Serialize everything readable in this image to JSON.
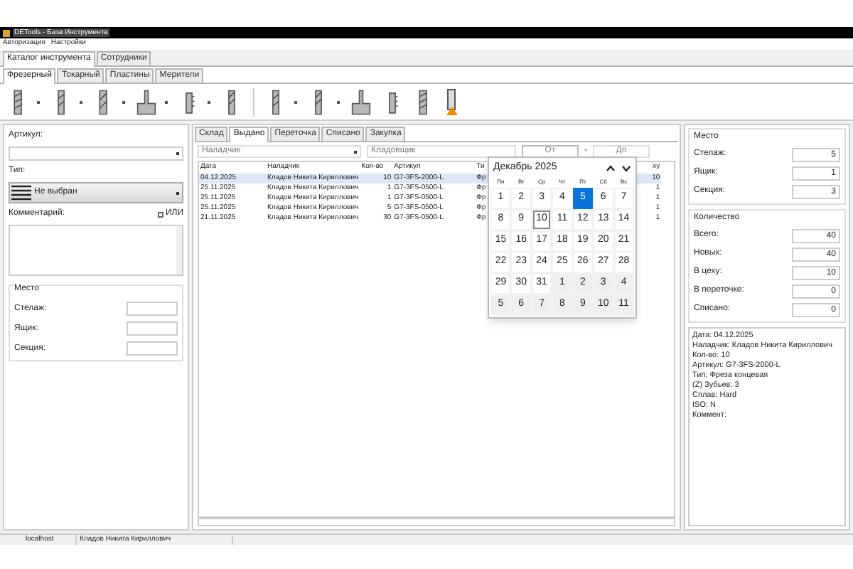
{
  "window": {
    "title": "DETools - База Инструмента"
  },
  "menu": [
    "Авторизация",
    "Настройки"
  ],
  "main_tabs": [
    {
      "label": "Каталог инструмента",
      "selected": true
    },
    {
      "label": "Сотрудники",
      "selected": false
    }
  ],
  "category_tabs": [
    {
      "label": "Фрезерный",
      "selected": true
    },
    {
      "label": "Токарный",
      "selected": false
    },
    {
      "label": "Пластины",
      "selected": false
    },
    {
      "label": "Мерители",
      "selected": false
    }
  ],
  "filters": {
    "article_label": "Артикул:",
    "type_label": "Тип:",
    "type_value": "Не выбран",
    "comment_label": "Комментарий:",
    "or_checkbox": {
      "label": "ИЛИ",
      "checked": false
    },
    "place": {
      "title": "Место",
      "fields": [
        "Стелаж:",
        "Ящик:",
        "Секция:"
      ]
    }
  },
  "record_tabs": [
    {
      "label": "Склад",
      "selected": false
    },
    {
      "label": "Выдано",
      "selected": true
    },
    {
      "label": "Переточка",
      "selected": false
    },
    {
      "label": "Списано",
      "selected": false
    },
    {
      "label": "Закупка",
      "selected": false
    }
  ],
  "record_filters": {
    "adjuster_value": "Наладчик",
    "storekeeper_placeholder": "Кладовщик",
    "from_placeholder": "От",
    "separator": "-",
    "to_placeholder": "До"
  },
  "table": {
    "columns": [
      "Дата",
      "Наладчик",
      "Кол-во",
      "Артикул",
      "Ти",
      "ху"
    ],
    "rows": [
      {
        "cells": [
          "04.12.2025",
          "Кладов Никита Кириллович",
          "10",
          "G7-3FS-2000-L",
          "Фр",
          "10"
        ],
        "selected": true
      },
      {
        "cells": [
          "25.11.2025",
          "Кладов Никита Кириллович",
          "1",
          "G7-3FS-0500-L",
          "Фр",
          "1"
        ],
        "selected": false
      },
      {
        "cells": [
          "25.11.2025",
          "Кладов Никита Кириллович",
          "1",
          "G7-3FS-0500-L",
          "Фр",
          "1"
        ],
        "selected": false
      },
      {
        "cells": [
          "25.11.2025",
          "Кладов Никита Кириллович",
          "5",
          "G7-3FS-0500-L",
          "Фр",
          "1"
        ],
        "selected": false
      },
      {
        "cells": [
          "21.11.2025",
          "Кладов Никита Кириллович",
          "30",
          "G7-3FS-0500-L",
          "Фр",
          "1"
        ],
        "selected": false
      }
    ]
  },
  "calendar": {
    "month": "Декабрь 2025",
    "weekdays": [
      "Пн",
      "Вт",
      "Ср",
      "Чт",
      "Пт",
      "Сб",
      "Вс"
    ],
    "days": [
      {
        "label": "1",
        "other_month": false,
        "selected": false,
        "today": false
      },
      {
        "label": "2",
        "other_month": false,
        "selected": false,
        "today": false
      },
      {
        "label": "3",
        "other_month": false,
        "selected": false,
        "today": false
      },
      {
        "label": "4",
        "other_month": false,
        "selected": false,
        "today": false
      },
      {
        "label": "5",
        "other_month": false,
        "selected": true,
        "today": false
      },
      {
        "label": "6",
        "other_month": false,
        "selected": false,
        "today": false
      },
      {
        "label": "7",
        "other_month": false,
        "selected": false,
        "today": false
      },
      {
        "label": "8",
        "other_month": false,
        "selected": false,
        "today": false
      },
      {
        "label": "9",
        "other_month": false,
        "selected": false,
        "today": false
      },
      {
        "label": "10",
        "other_month": false,
        "selected": false,
        "today": true
      },
      {
        "label": "11",
        "other_month": false,
        "selected": false,
        "today": false
      },
      {
        "label": "12",
        "other_month": false,
        "selected": false,
        "today": false
      },
      {
        "label": "13",
        "other_month": false,
        "selected": false,
        "today": false
      },
      {
        "label": "14",
        "other_month": false,
        "selected": false,
        "today": false
      },
      {
        "label": "15",
        "other_month": false,
        "selected": false,
        "today": false
      },
      {
        "label": "16",
        "other_month": false,
        "selected": false,
        "today": false
      },
      {
        "label": "17",
        "other_month": false,
        "selected": false,
        "today": false
      },
      {
        "label": "18",
        "other_month": false,
        "selected": false,
        "today": false
      },
      {
        "label": "19",
        "other_month": false,
        "selected": false,
        "today": false
      },
      {
        "label": "20",
        "other_month": false,
        "selected": false,
        "today": false
      },
      {
        "label": "21",
        "other_month": false,
        "selected": false,
        "today": false
      },
      {
        "label": "22",
        "other_month": false,
        "selected": false,
        "today": false
      },
      {
        "label": "23",
        "other_month": false,
        "selected": false,
        "today": false
      },
      {
        "label": "24",
        "other_month": false,
        "selected": false,
        "today": false
      },
      {
        "label": "25",
        "other_month": false,
        "selected": false,
        "today": false
      },
      {
        "label": "26",
        "other_month": false,
        "selected": false,
        "today": false
      },
      {
        "label": "27",
        "other_month": false,
        "selected": false,
        "today": false
      },
      {
        "label": "28",
        "other_month": false,
        "selected": false,
        "today": false
      },
      {
        "label": "29",
        "other_month": false,
        "selected": false,
        "today": false
      },
      {
        "label": "30",
        "other_month": false,
        "selected": false,
        "today": false
      },
      {
        "label": "31",
        "other_month": false,
        "selected": false,
        "today": false
      },
      {
        "label": "1",
        "other_month": true,
        "selected": false,
        "today": false
      },
      {
        "label": "2",
        "other_month": true,
        "selected": false,
        "today": false
      },
      {
        "label": "3",
        "other_month": true,
        "selected": false,
        "today": false
      },
      {
        "label": "4",
        "other_month": true,
        "selected": false,
        "today": false
      },
      {
        "label": "5",
        "other_month": true,
        "selected": false,
        "today": false
      },
      {
        "label": "6",
        "other_month": true,
        "selected": false,
        "today": false
      },
      {
        "label": "7",
        "other_month": true,
        "selected": false,
        "today": false
      },
      {
        "label": "8",
        "other_month": true,
        "selected": false,
        "today": false
      },
      {
        "label": "9",
        "other_month": true,
        "selected": false,
        "today": false
      },
      {
        "label": "10",
        "other_month": true,
        "selected": false,
        "today": false
      },
      {
        "label": "11",
        "other_month": true,
        "selected": false,
        "today": false
      }
    ]
  },
  "details": {
    "place": {
      "title": "Место",
      "fields": [
        {
          "label": "Стелаж:",
          "value": "5"
        },
        {
          "label": "Ящик:",
          "value": "1"
        },
        {
          "label": "Секция:",
          "value": "3"
        }
      ]
    },
    "quantity": {
      "title": "Количество",
      "fields": [
        {
          "label": "Всего:",
          "value": "40"
        },
        {
          "label": "Новых:",
          "value": "40"
        },
        {
          "label": "В цеху:",
          "value": "10"
        },
        {
          "label": "В переточке:",
          "value": "0"
        },
        {
          "label": "Списано:",
          "value": "0"
        }
      ]
    },
    "info_lines": [
      "Дата: 04.12.2025",
      "Наладчик: Кладов Никита Кириллович",
      "Кол-во: 10",
      "Артикул: G7-3FS-2000-L",
      "Тип: Фреза концевая",
      "(Z) Зубьев: 3",
      "Сплав: Hard",
      "ISO: N",
      "Коммент:"
    ]
  },
  "status_bar": [
    "localhost",
    "Кладов Никита Кириллович"
  ]
}
